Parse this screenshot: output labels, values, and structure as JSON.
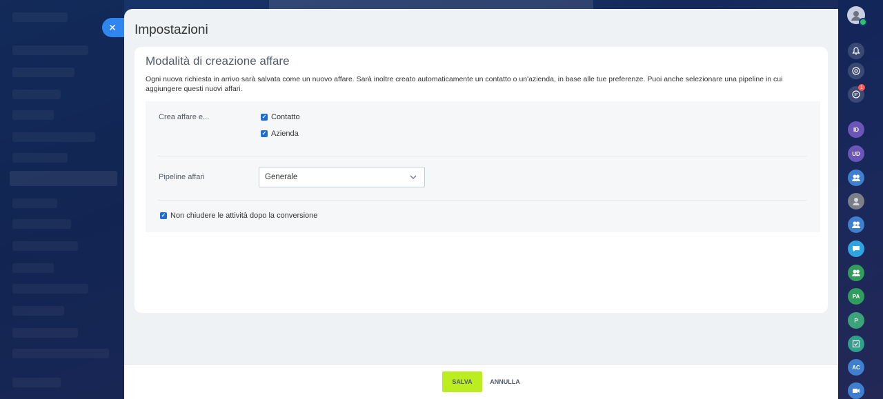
{
  "slider": {
    "title": "Impostazioni",
    "close_icon": "close-icon"
  },
  "card": {
    "title": "Modalità di creazione affare",
    "description": "Ogni nuova richiesta in arrivo sarà salvata come un nuovo affare. Sarà inoltre creato automaticamente un contatto o un'azienda, in base alle tue preferenze. Puoi anche selezionare una pipeline in cui aggiungere questi nuovi affari."
  },
  "options": {
    "create_label": "Crea affare e...",
    "contact_label": "Contatto",
    "contact_checked": true,
    "company_label": "Azienda",
    "company_checked": true,
    "pipeline_label": "Pipeline affari",
    "pipeline_value": "Generale",
    "keep_open_label": "Non chiudere le attività dopo la conversione",
    "keep_open_checked": true
  },
  "footer": {
    "save_label": "SALVA",
    "cancel_label": "ANNULLA"
  },
  "colors": {
    "accent_blue": "#2f86ef",
    "checkbox_blue": "#1e6dd4",
    "save_green": "#bbed21",
    "badge_red": "#ff5752"
  },
  "rightbar": {
    "badge_count": "1",
    "items": [
      "ID",
      "UD",
      "PA",
      "P",
      "AC"
    ]
  }
}
